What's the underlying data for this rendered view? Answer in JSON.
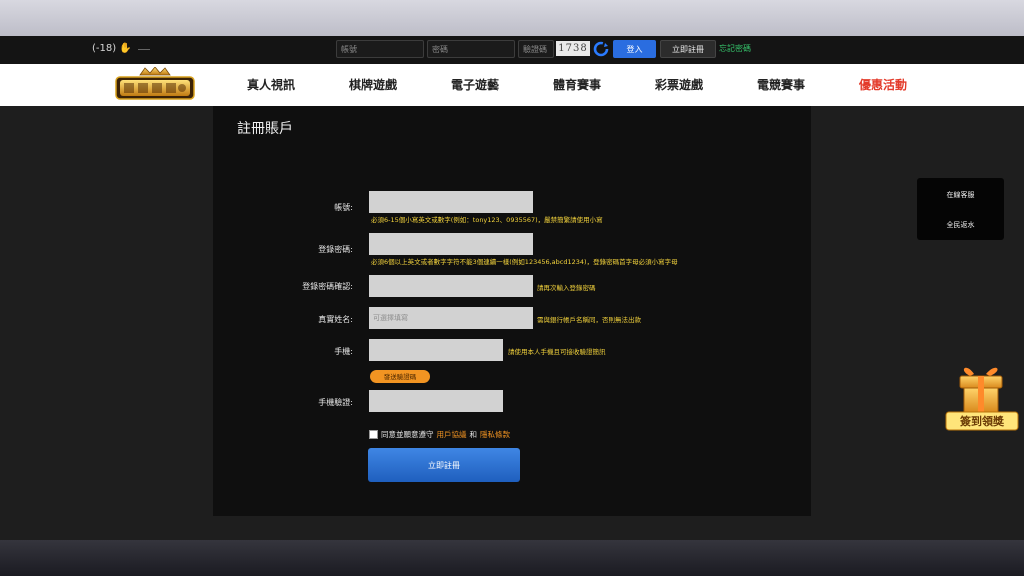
{
  "topbar": {
    "age_badge": "(-18)",
    "username_placeholder": "帳號",
    "password_placeholder": "密碼",
    "captcha_placeholder": "驗證碼",
    "captcha_text": "1738",
    "login_label": "登入",
    "register_label": "立即註冊",
    "forgot_label": "忘記密碼"
  },
  "nav": {
    "items": [
      {
        "label": "真人視訊"
      },
      {
        "label": "棋牌遊戲"
      },
      {
        "label": "電子遊藝"
      },
      {
        "label": "體育賽事"
      },
      {
        "label": "彩票遊戲"
      },
      {
        "label": "電競賽事"
      },
      {
        "label": "優惠活動"
      }
    ]
  },
  "form": {
    "title": "註冊賬戶",
    "account": {
      "label": "帳號:",
      "hint": "必須6-15個小寫英文或數字(例如：tony123、0935567)，嚴禁簡繁請使用小寫"
    },
    "password": {
      "label": "登錄密碼:",
      "hint": "必須6個以上英文或者數字字符不能3個連續一樣(例如123456,abcd1234)，登錄密碼首字母必須小寫字母"
    },
    "password_confirm": {
      "label": "登錄密碼確認:",
      "hint": "請再次輸入登錄密碼"
    },
    "real_name": {
      "label": "真實姓名:",
      "placeholder": "可選擇填寫",
      "hint": "需與銀行帳戶名稱同，否則無法出款"
    },
    "phone": {
      "label": "手機:",
      "hint": "請使用本人手機且可接收驗證簡訊"
    },
    "send_code_label": "發送驗證碼",
    "phone_verify": {
      "label": "手機驗證:"
    },
    "agree": {
      "prefix": "同意並願意遵守",
      "terms": "用戶協議",
      "and": "和",
      "privacy": "隱私條款"
    },
    "submit_label": "立即註冊"
  },
  "side": {
    "support_label": "在線客服",
    "rebate_label": "全民返水"
  },
  "gift": {
    "label": "簽到領獎"
  },
  "colors": {
    "promo": "#e33a2a",
    "hint": "#f2d23c",
    "accent_blue": "#2a6de0",
    "orange": "#f29422",
    "link_green": "#36c46b"
  }
}
